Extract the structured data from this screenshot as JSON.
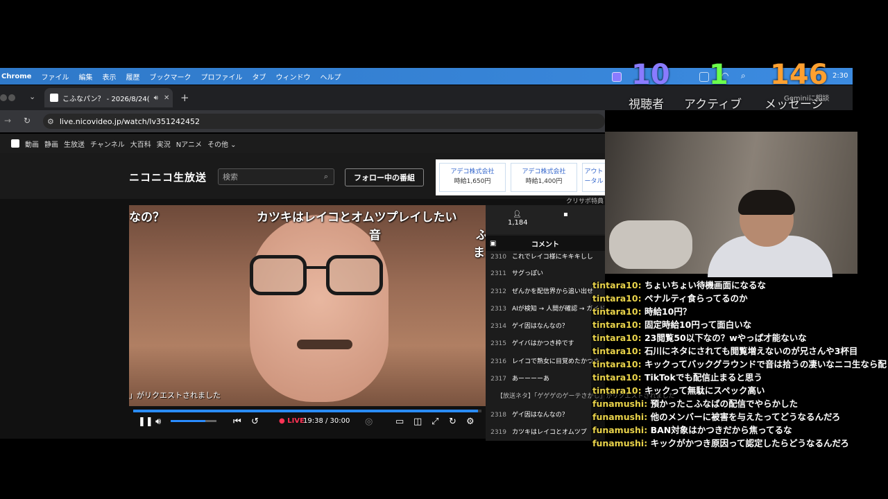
{
  "menubar": {
    "items": [
      "Chrome",
      "ファイル",
      "編集",
      "表示",
      "履歴",
      "ブックマーク",
      "プロファイル",
      "タブ",
      "ウィンドウ",
      "ヘルプ"
    ],
    "clock": "2:30"
  },
  "tab": {
    "title": "こふなパン？ - 2026/8/24("
  },
  "address": {
    "url": "live.nicovideo.jp/watch/lv351242452"
  },
  "bookmarks": [
    "動画",
    "静画",
    "生放送",
    "チャンネル",
    "大百科",
    "実況",
    "Nアニメ",
    "その他 ⌄"
  ],
  "header": {
    "logo": "ニコニコ生放送",
    "search_placeholder": "検索",
    "follow_button": "フォロー中の番組",
    "ads": [
      {
        "company": "アデコ株式会社",
        "wage": "時給1,650円"
      },
      {
        "company": "アデコ株式会社",
        "wage": "時給1,400円"
      },
      {
        "company": "アウト",
        "wage": "ータル"
      }
    ],
    "crisapo": "クリサポ特典"
  },
  "video": {
    "danmaku": [
      {
        "text": "なの？"
      },
      {
        "text": "カツキはレイコとオムツプレイしたい"
      },
      {
        "text": "音"
      },
      {
        "text": "ふ"
      },
      {
        "text": "ま"
      }
    ],
    "request_msg": "」がリクエストされました",
    "live_label": "● LIVE",
    "time": "19:38 / 30:00",
    "progress_fraction": 0.99,
    "volume_fraction": 0.75
  },
  "comment_panel": {
    "viewer_count": "1,184",
    "tab_label": "コメント",
    "comments": [
      {
        "no": "2310",
        "text": "これでレイコ様にキキキしし"
      },
      {
        "no": "2311",
        "text": "サグっぽい"
      },
      {
        "no": "2312",
        "text": "ぜんかを配信界から追い出せ"
      },
      {
        "no": "2313",
        "text": "AIが検知 → 人間が確認 → ガイドラインに違反"
      },
      {
        "no": "2314",
        "text": "ゲイ因はなんなの？"
      },
      {
        "no": "2315",
        "text": "ゲイバはかつき枠です"
      },
      {
        "no": "2316",
        "text": "レイコで熟女に目覚めたかつき"
      },
      {
        "no": "2317",
        "text": "あーーーーあ"
      },
      {
        "no": "2318",
        "text": "ゲイ因はなんなの？"
      },
      {
        "no": "2319",
        "text": "カツキはレイコとオムツプ"
      }
    ],
    "system_notice": "【放送ネタ】「ゲゲゲのゲーテさかし」がリクエストされました"
  },
  "overlay_stats": {
    "viewers": {
      "value": "10",
      "label": "視聴者"
    },
    "active": {
      "value": "1",
      "label": "アクティブ"
    },
    "messages": {
      "value": "146",
      "label": "メッセージ"
    },
    "gemini": "Geminiに相談"
  },
  "chat": [
    {
      "user": "tintara10",
      "msg": "ちょいちょい待機画面になるな"
    },
    {
      "user": "tintara10",
      "msg": "ペナルティ食らってるのか"
    },
    {
      "user": "tintara10",
      "msg": "時給10円？"
    },
    {
      "user": "tintara10",
      "msg": "固定時給10円って面白いな"
    },
    {
      "user": "tintara10",
      "msg": "23閲覧50以下なの？wやっぱ才能ないな"
    },
    {
      "user": "tintara10",
      "msg": "石川にネタにされても閲覧増えないのが兄さんや3杯目"
    },
    {
      "user": "tintara10",
      "msg": "キックってバックグラウンドで音は拾うの凄いなニコ生なら配"
    },
    {
      "user": "tintara10",
      "msg": "TikTokでも配信止まると思う"
    },
    {
      "user": "tintara10",
      "msg": "キックって無駄にスペック高い"
    },
    {
      "user": "funamushi",
      "msg": "預かったこふなばの配信でやらかした"
    },
    {
      "user": "funamushi",
      "msg": "他のメンバーに被害を与えたってどうなるんだろ"
    },
    {
      "user": "funamushi",
      "msg": "BAN対象はかつきだから焦ってるな"
    },
    {
      "user": "funamushi",
      "msg": "キックがかつき原因って認定したらどうなるんだろ"
    }
  ],
  "colors": {
    "accent": "#2a8cff",
    "live": "#ff3355",
    "username": "#e8d24a",
    "viewers_num": "#8a7bff",
    "active_num": "#6bff4a",
    "messages_num": "#ffa030"
  }
}
